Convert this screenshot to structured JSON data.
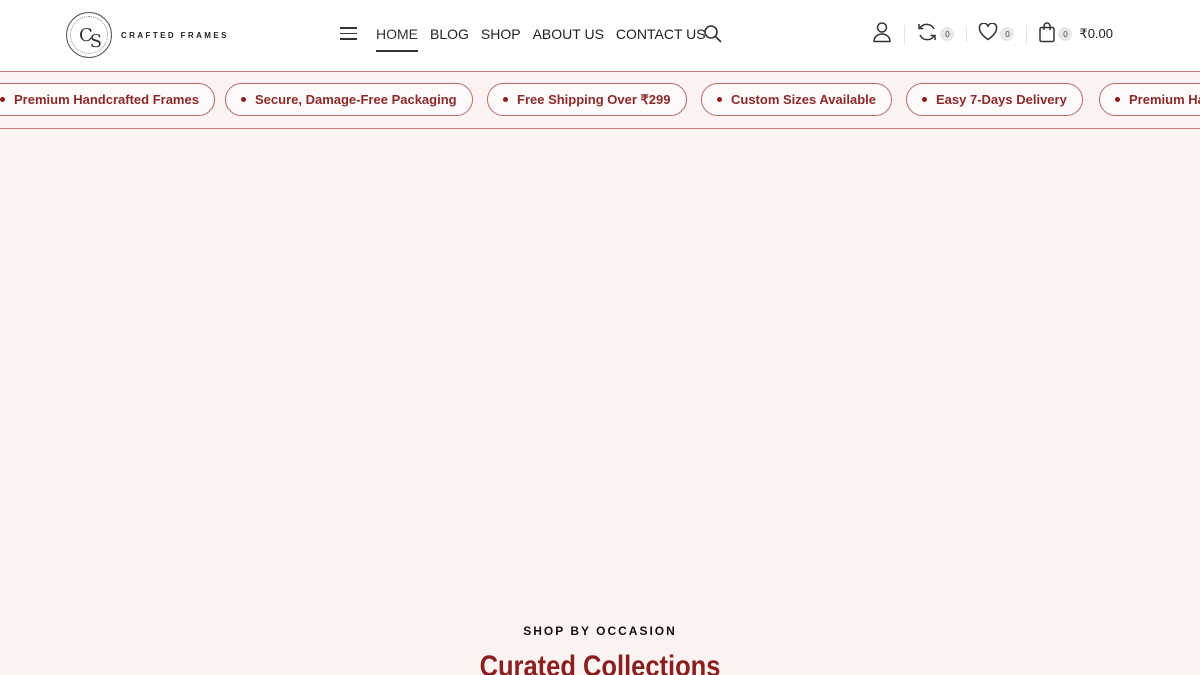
{
  "brand": {
    "logo_letters_1": "C",
    "logo_letters_2": "S",
    "name": "CRAFTED FRAMES"
  },
  "nav": {
    "items": [
      {
        "label": "HOME",
        "active": true
      },
      {
        "label": "BLOG"
      },
      {
        "label": "SHOP"
      },
      {
        "label": "ABOUT US"
      },
      {
        "label": "CONTACT US"
      }
    ]
  },
  "header_icons": {
    "compare_count": "0",
    "wishlist_count": "0",
    "cart_count": "0",
    "cart_total": "₹0.00"
  },
  "features": [
    "Premium Handcrafted Frames",
    "Secure, Damage-Free Packaging",
    "Free Shipping Over ₹299",
    "Custom Sizes Available",
    "Easy 7-Days Delivery",
    "Premium Handcrafted Frames"
  ],
  "section": {
    "eyebrow": "SHOP BY OCCASION",
    "title": "Curated Collections"
  },
  "colors": {
    "accent": "#8b1f1f",
    "background": "#fdf3f3",
    "pill_border": "#b86b6b"
  }
}
